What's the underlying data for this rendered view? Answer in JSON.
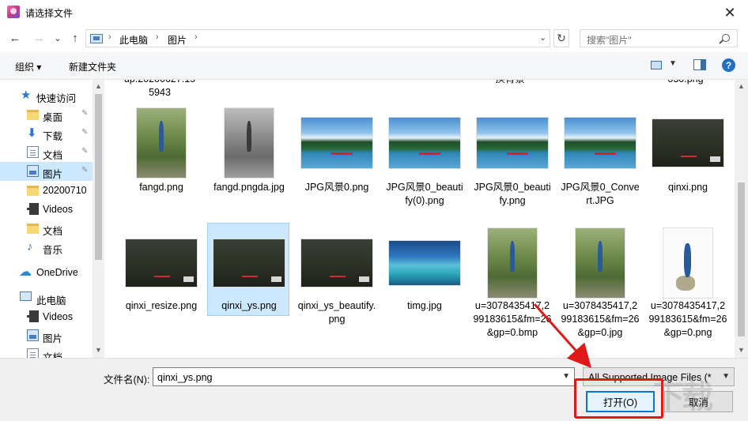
{
  "window": {
    "title": "请选择文件",
    "close_label": "✕"
  },
  "nav": {
    "back": "←",
    "forward": "→",
    "recent": "⌄",
    "up": "↑",
    "breadcrumb": [
      "此电脑",
      "图片"
    ],
    "crumb_sep": "›",
    "refresh": "↻",
    "search_placeholder": "搜索\"图片\""
  },
  "toolbar": {
    "organize": "组织 ▾",
    "new_folder": "新建文件夹",
    "help": "?"
  },
  "sidebar": {
    "items": [
      {
        "label": "快速访问",
        "icon": "star-icon"
      },
      {
        "label": "桌面",
        "icon": "folder-icon",
        "pinned": true
      },
      {
        "label": "下载",
        "icon": "download-icon",
        "pinned": true
      },
      {
        "label": "文档",
        "icon": "document-icon",
        "pinned": true
      },
      {
        "label": "图片",
        "icon": "pictures-icon",
        "pinned": true,
        "selected": true
      },
      {
        "label": "20200710",
        "icon": "folder-icon"
      },
      {
        "label": "Videos",
        "icon": "video-icon"
      },
      {
        "label": "文档",
        "icon": "folder-icon"
      },
      {
        "label": "音乐",
        "icon": "music-icon"
      },
      {
        "label": "OneDrive",
        "icon": "cloud-icon"
      },
      {
        "label": "此电脑",
        "icon": "computer-icon"
      },
      {
        "label": "Videos",
        "icon": "video-icon"
      },
      {
        "label": "图片",
        "icon": "pictures-icon"
      },
      {
        "label": "文档",
        "icon": "document-icon"
      }
    ],
    "pin_glyph": "📌"
  },
  "files": {
    "partial_top": [
      "up.20200627.15\n5943",
      "换背景",
      "030.png"
    ],
    "row1": [
      {
        "name": "fangd.png",
        "thumb": "person"
      },
      {
        "name": "fangd.pngda.jpg",
        "thumb": "gray"
      },
      {
        "name": "JPG风景0.png",
        "thumb": "lake"
      },
      {
        "name": "JPG风景0_beautify(0).png",
        "thumb": "lake"
      },
      {
        "name": "JPG风景0_beautify.png",
        "thumb": "lake"
      },
      {
        "name": "JPG风景0_Convert.JPG",
        "thumb": "lake"
      },
      {
        "name": "qinxi.png",
        "thumb": "dark"
      }
    ],
    "row2": [
      {
        "name": "qinxi_resize.png",
        "thumb": "dark"
      },
      {
        "name": "qinxi_ys.png",
        "thumb": "dark",
        "selected": true
      },
      {
        "name": "qinxi_ys_beautify.png",
        "thumb": "dark"
      },
      {
        "name": "timg.jpg",
        "thumb": "sea"
      },
      {
        "name": "u=3078435417,299183615&fm=26&gp=0.bmp",
        "thumb": "person"
      },
      {
        "name": "u=3078435417,299183615&fm=26&gp=0.jpg",
        "thumb": "person"
      },
      {
        "name": "u=3078435417,299183615&fm=26&gp=0.png",
        "thumb": "white"
      }
    ]
  },
  "bottom": {
    "filename_label": "文件名(N):",
    "filename_value": "qinxi_ys.png",
    "filetype_value": "All Supported Image Files (*",
    "open_label": "打开(O)",
    "cancel_label": "取消"
  },
  "colors": {
    "accent": "#0078d7",
    "selection": "#cce8ff",
    "annotation": "#e01818"
  }
}
